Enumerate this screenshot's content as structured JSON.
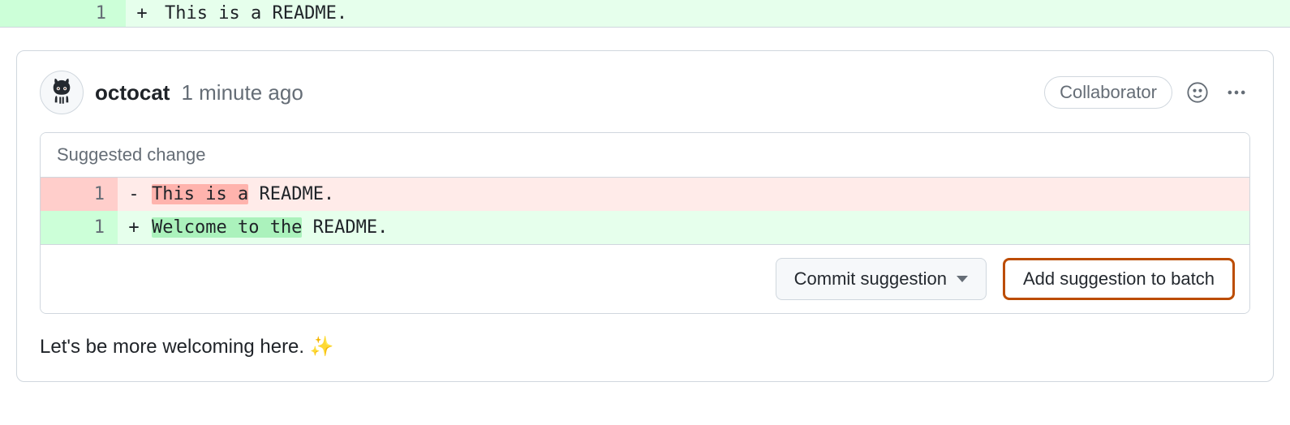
{
  "top_diff": {
    "line_num": "1",
    "marker": "+",
    "code": "This is a README."
  },
  "comment": {
    "author": "octocat",
    "timestamp": "1 minute ago",
    "badge": "Collaborator",
    "body": "Let's be more welcoming here. ",
    "emoji": "✨"
  },
  "suggestion": {
    "title": "Suggested change",
    "deletion": {
      "line_num": "1",
      "marker": "-",
      "highlight": "This is a",
      "rest": " README."
    },
    "addition": {
      "line_num": "1",
      "marker": "+",
      "highlight": "Welcome to the",
      "rest": " README."
    },
    "actions": {
      "commit": "Commit suggestion",
      "add_batch": "Add suggestion to batch"
    }
  }
}
